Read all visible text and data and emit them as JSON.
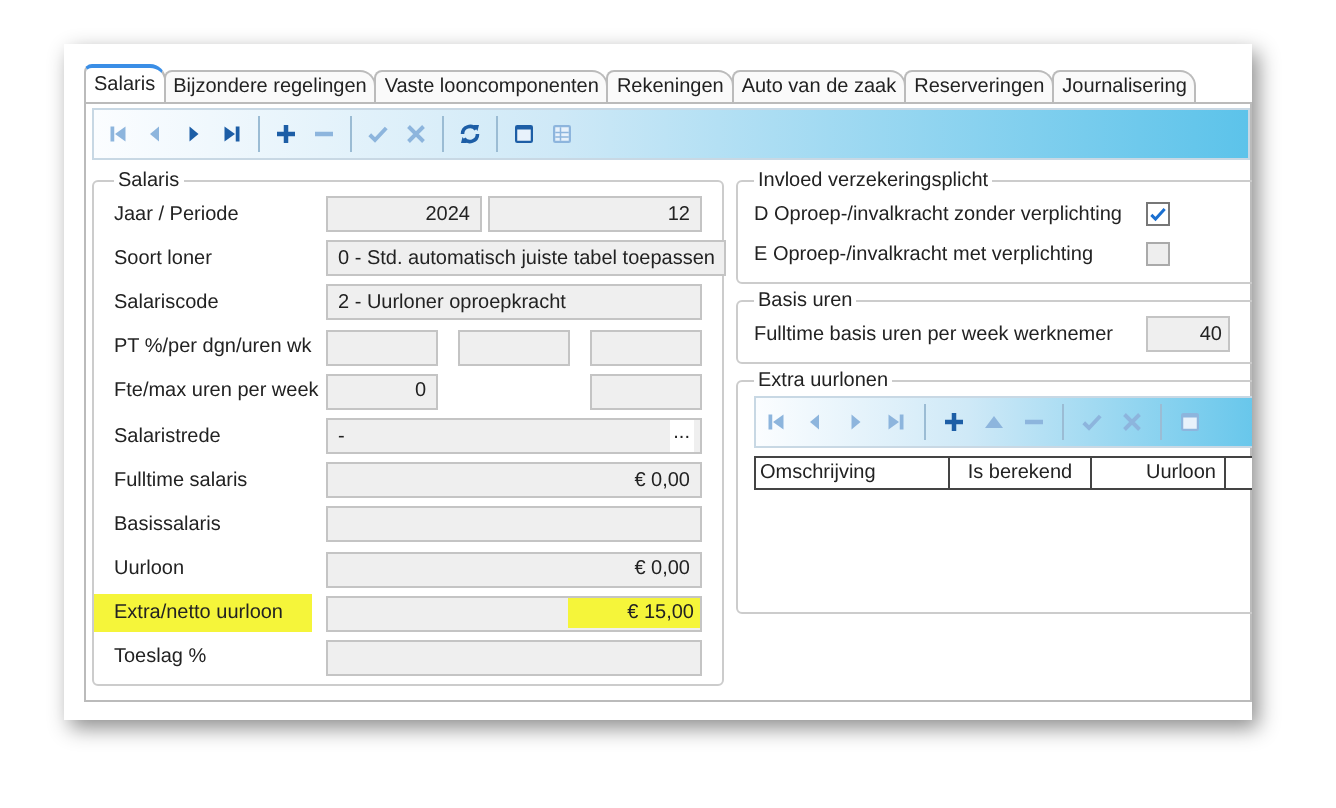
{
  "tabs": [
    {
      "label": "Salaris",
      "selected": true
    },
    {
      "label": "Bijzondere regelingen",
      "selected": false
    },
    {
      "label": "Vaste looncomponenten",
      "selected": false
    },
    {
      "label": "Rekeningen",
      "selected": false
    },
    {
      "label": "Auto van de zaak",
      "selected": false
    },
    {
      "label": "Reserveringen",
      "selected": false
    },
    {
      "label": "Journalisering",
      "selected": false
    }
  ],
  "toolbar": [
    {
      "kind": "first",
      "disabled": true
    },
    {
      "kind": "prev",
      "disabled": true
    },
    {
      "kind": "next",
      "disabled": false
    },
    {
      "kind": "last",
      "disabled": false
    },
    {
      "kind": "sep"
    },
    {
      "kind": "add",
      "disabled": false
    },
    {
      "kind": "remove",
      "disabled": true
    },
    {
      "kind": "sep"
    },
    {
      "kind": "confirm",
      "disabled": true
    },
    {
      "kind": "cancel",
      "disabled": true
    },
    {
      "kind": "sep"
    },
    {
      "kind": "refresh",
      "disabled": false
    },
    {
      "kind": "sep"
    },
    {
      "kind": "form",
      "disabled": false
    },
    {
      "kind": "grid",
      "disabled": true
    }
  ],
  "salaris": {
    "title": "Salaris",
    "rows": [
      {
        "label": "Jaar / Periode",
        "highlighted": false,
        "fields": [
          {
            "kind": "number",
            "value": "2024"
          },
          {
            "kind": "number",
            "value": "12"
          }
        ]
      },
      {
        "label": "Soort loner",
        "highlighted": false,
        "fields": [
          {
            "kind": "text",
            "value": "0 - Std. automatisch juiste tabel toepassen"
          }
        ]
      },
      {
        "label": "Salariscode",
        "highlighted": false,
        "fields": [
          {
            "kind": "text",
            "value": "2 - Uurloner oproepkracht"
          }
        ]
      },
      {
        "label": "PT %/per dgn/uren wk",
        "highlighted": false,
        "fields": [
          {
            "kind": "number"
          },
          {
            "kind": "number"
          },
          {
            "kind": "number"
          }
        ]
      },
      {
        "label": "Fte/max uren per week",
        "highlighted": false,
        "fields": [
          {
            "kind": "number",
            "value": "0"
          },
          {
            "kind": "none"
          },
          {
            "kind": "number"
          }
        ]
      },
      {
        "label": "Salaristrede",
        "highlighted": false,
        "fields": [
          {
            "kind": "text",
            "value": "-",
            "button": "..."
          }
        ]
      },
      {
        "label": "Fulltime salaris",
        "highlighted": false,
        "fields": [
          {
            "kind": "number",
            "value": "€ 0,00"
          }
        ]
      },
      {
        "label": "Basissalaris",
        "highlighted": false,
        "fields": [
          {
            "kind": "number"
          }
        ]
      },
      {
        "label": "Uurloon",
        "highlighted": false,
        "fields": [
          {
            "kind": "number",
            "value": "€ 0,00"
          }
        ]
      },
      {
        "label": "Extra/netto uurloon",
        "highlighted": true,
        "fields": [
          {
            "kind": "number",
            "value": "€ 15,00"
          }
        ]
      },
      {
        "label": "Toeslag %",
        "highlighted": false,
        "fields": [
          {
            "kind": "number"
          }
        ]
      }
    ]
  },
  "verzekeringsplicht": {
    "title": "Invloed verzekeringsplicht",
    "options": [
      {
        "label": "D Oproep-/invalkracht zonder verplichting",
        "checked": true
      },
      {
        "label": "E Oproep-/invalkracht met verplichting",
        "checked": false
      }
    ]
  },
  "basis_uren": {
    "title": "Basis uren",
    "label": "Fulltime basis uren per week werknemer",
    "value": "40"
  },
  "extra_uurlonen": {
    "title": "Extra uurlonen",
    "toolbar": [
      {
        "kind": "first",
        "disabled": true
      },
      {
        "kind": "prev",
        "disabled": true
      },
      {
        "kind": "next",
        "disabled": true
      },
      {
        "kind": "last",
        "disabled": true
      },
      {
        "kind": "sep"
      },
      {
        "kind": "add",
        "disabled": false
      },
      {
        "kind": "up",
        "disabled": true
      },
      {
        "kind": "remove",
        "disabled": true
      },
      {
        "kind": "sep"
      },
      {
        "kind": "confirm",
        "disabled": true
      },
      {
        "kind": "cancel",
        "disabled": true
      },
      {
        "kind": "sep"
      },
      {
        "kind": "form",
        "disabled": true
      }
    ],
    "columns": [
      "Omschrijving",
      "Is berekend",
      "Uurloon"
    ]
  }
}
